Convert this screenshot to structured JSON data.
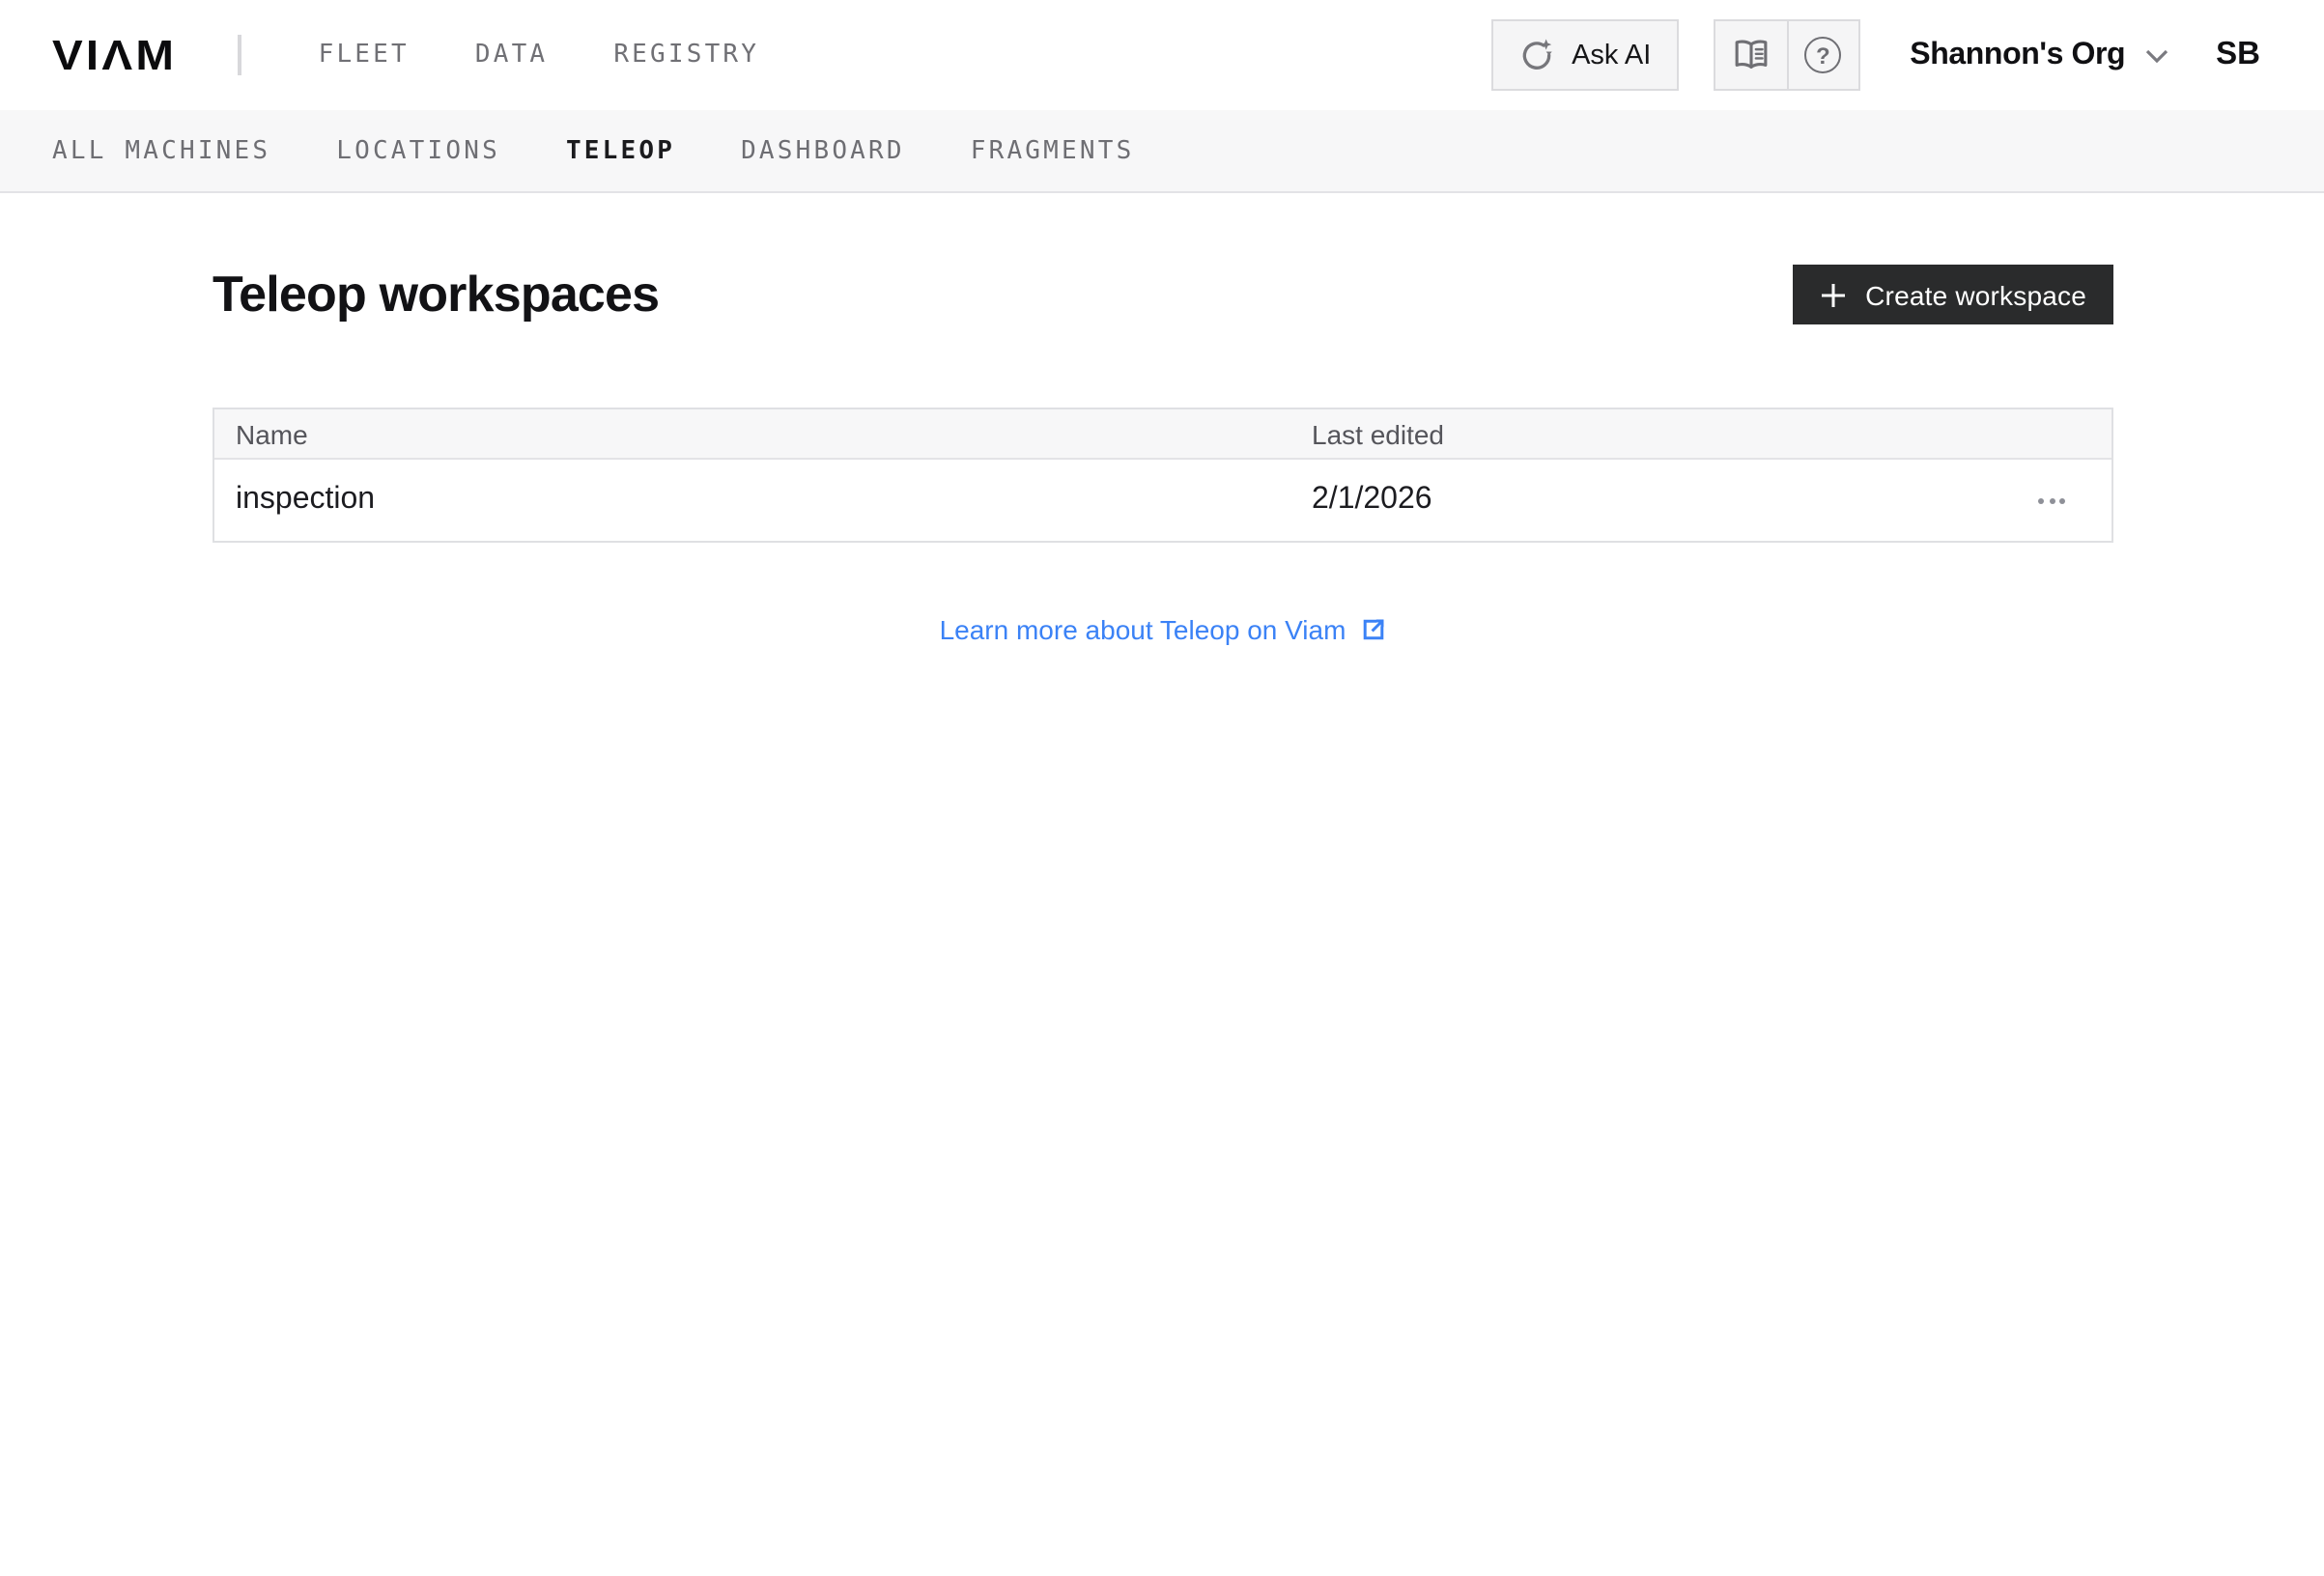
{
  "header": {
    "logo_text": "VIΛM",
    "nav_items": [
      {
        "label": "FLEET"
      },
      {
        "label": "DATA"
      },
      {
        "label": "REGISTRY"
      }
    ],
    "ask_ai": {
      "label": "Ask AI",
      "icon": "ask-ai-sparkle-icon"
    },
    "utility": {
      "docs_icon": "open-book-icon",
      "help_icon": "question-circle-icon",
      "help_glyph": "?"
    },
    "org": {
      "name": "Shannon's Org",
      "icon": "chevron-down-icon"
    },
    "avatar": {
      "initials": "SB"
    }
  },
  "subnav": {
    "items": [
      {
        "label": "ALL MACHINES",
        "active": false
      },
      {
        "label": "LOCATIONS",
        "active": false
      },
      {
        "label": "TELEOP",
        "active": true
      },
      {
        "label": "DASHBOARD",
        "active": false
      },
      {
        "label": "FRAGMENTS",
        "active": false
      }
    ]
  },
  "page": {
    "title": "Teleop workspaces",
    "create_button": {
      "label": "Create workspace",
      "icon": "plus-icon"
    },
    "table": {
      "columns": [
        {
          "label": "Name"
        },
        {
          "label": "Last edited"
        }
      ],
      "rows": [
        {
          "name": "inspection",
          "last_edited": "2/1/2026",
          "menu_icon": "ellipsis-icon"
        }
      ]
    },
    "footer_link": {
      "label": "Learn more about Teleop on Viam",
      "icon": "external-link-icon"
    }
  },
  "colors": {
    "link_blue": "#3b82f6",
    "button_dark": "#2a2b2c",
    "subnav_bg": "#f7f7f8",
    "table_header_bg": "#f7f7f8",
    "border_gray": "#dfe0e3",
    "nav_text_gray": "#707075",
    "active_text": "#1b1b1e"
  }
}
